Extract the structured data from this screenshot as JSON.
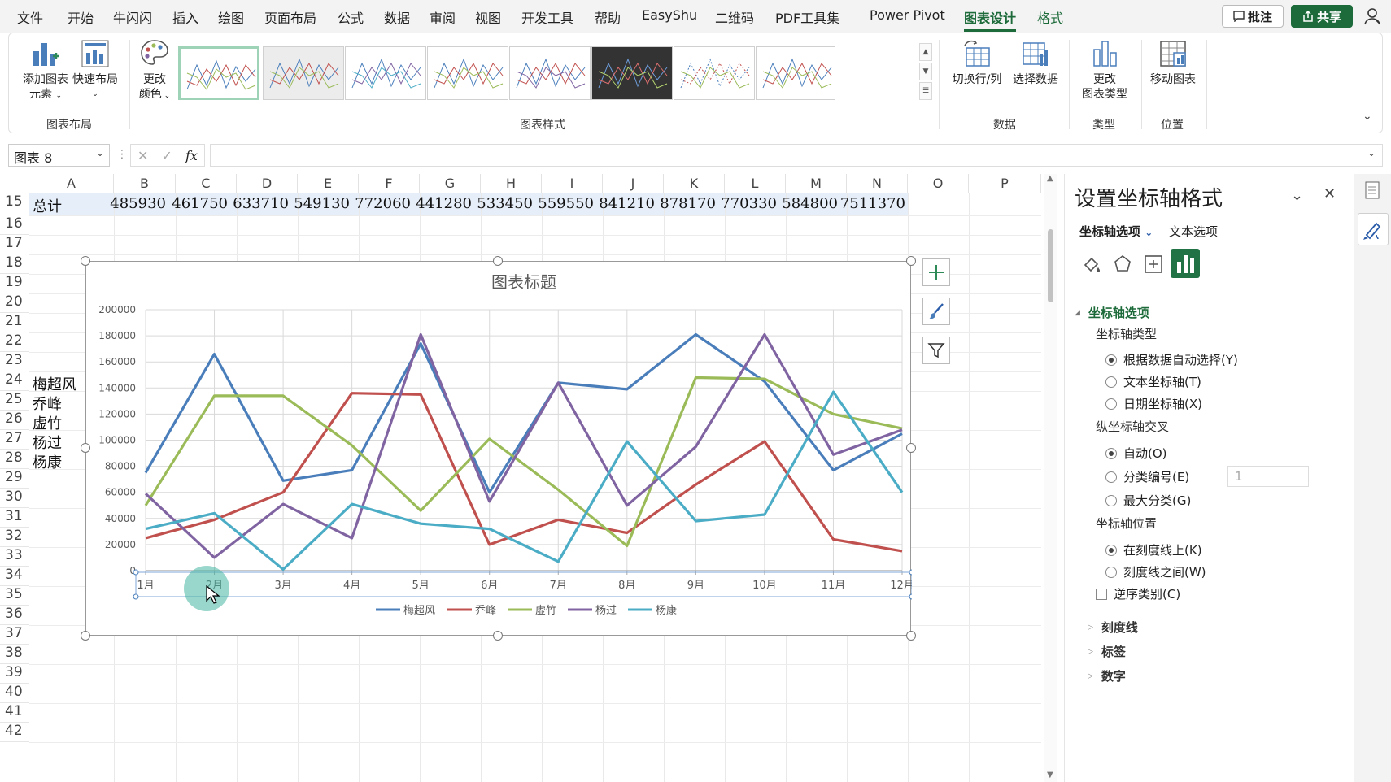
{
  "menu": {
    "items": [
      "文件",
      "开始",
      "牛闪闪",
      "插入",
      "绘图",
      "页面布局",
      "公式",
      "数据",
      "审阅",
      "视图",
      "开发工具",
      "帮助",
      "EasyShu",
      "二维码",
      "PDF工具集",
      "Power Pivot",
      "图表设计",
      "格式"
    ],
    "comment_label": "批注",
    "share_label": "共享"
  },
  "ribbon": {
    "add_element_l1": "添加图表",
    "add_element_l2": "元素",
    "quick_layout": "快速布局",
    "group_layout": "图表布局",
    "change_color_l1": "更改",
    "change_color_l2": "颜色",
    "group_styles": "图表样式",
    "switch_rowcol": "切换行/列",
    "select_data": "选择数据",
    "group_data": "数据",
    "change_type_l1": "更改",
    "change_type_l2": "图表类型",
    "group_type": "类型",
    "move_chart": "移动图表",
    "group_location": "位置"
  },
  "formula_bar": {
    "name_box": "图表 8",
    "fx": "fx"
  },
  "sheet": {
    "columns": [
      "A",
      "B",
      "C",
      "D",
      "E",
      "F",
      "G",
      "H",
      "I",
      "J",
      "K",
      "L",
      "M",
      "N",
      "O",
      "P"
    ],
    "rows": [
      "15",
      "16",
      "17",
      "18",
      "19",
      "20",
      "21",
      "22",
      "23",
      "24",
      "25",
      "26",
      "27",
      "28",
      "29",
      "30",
      "31",
      "32",
      "33",
      "34",
      "35",
      "36",
      "37",
      "38",
      "39",
      "40",
      "41",
      "42"
    ],
    "total_label": "总计",
    "total_values": [
      "485930",
      "461750",
      "633710",
      "549130",
      "772060",
      "441280",
      "533450",
      "559550",
      "841210",
      "878170",
      "770330",
      "584800",
      "7511370"
    ],
    "names": [
      "梅超风",
      "乔峰",
      "虚竹",
      "杨过",
      "杨康"
    ]
  },
  "chart_data": {
    "type": "line",
    "title": "图表标题",
    "categories": [
      "1月",
      "2月",
      "3月",
      "4月",
      "5月",
      "6月",
      "7月",
      "8月",
      "9月",
      "10月",
      "11月",
      "12月"
    ],
    "ylim": [
      0,
      200000
    ],
    "yticks": [
      "0",
      "20000",
      "40000",
      "60000",
      "80000",
      "100000",
      "120000",
      "140000",
      "160000",
      "180000",
      "200000"
    ],
    "grid": true,
    "legend_position": "bottom",
    "series": [
      {
        "name": "梅超风",
        "color": "#4a7ebb",
        "values": [
          75000,
          166000,
          69000,
          77000,
          174000,
          60000,
          144000,
          139000,
          181000,
          145000,
          77000,
          105000
        ]
      },
      {
        "name": "乔峰",
        "color": "#c0504d",
        "values": [
          25000,
          39000,
          60000,
          136000,
          135000,
          20000,
          39000,
          29000,
          66000,
          99000,
          24000,
          15000
        ]
      },
      {
        "name": "虚竹",
        "color": "#9bbb59",
        "values": [
          50000,
          134000,
          134000,
          96000,
          46000,
          101000,
          62000,
          19000,
          148000,
          147000,
          120000,
          109000
        ]
      },
      {
        "name": "杨过",
        "color": "#8064a2",
        "values": [
          59000,
          10000,
          51000,
          25000,
          181000,
          53000,
          144000,
          50000,
          95000,
          181000,
          89000,
          108000
        ]
      },
      {
        "name": "杨康",
        "color": "#4bacc6",
        "values": [
          32000,
          44000,
          1000,
          51000,
          36000,
          32000,
          7000,
          99000,
          38000,
          43000,
          137000,
          60000
        ]
      }
    ]
  },
  "pane": {
    "title": "设置坐标轴格式",
    "tab_axis_options": "坐标轴选项",
    "tab_text_options": "文本选项",
    "section_axis_options": "坐标轴选项",
    "axis_type_label": "坐标轴类型",
    "auto_select": "根据数据自动选择(Y)",
    "text_axis": "文本坐标轴(T)",
    "date_axis": "日期坐标轴(X)",
    "vertical_cross_label": "纵坐标轴交叉",
    "cross_auto": "自动(O)",
    "cross_category_number": "分类编号(E)",
    "cross_category_value": "1",
    "cross_max_category": "最大分类(G)",
    "axis_position_label": "坐标轴位置",
    "on_tick_marks": "在刻度线上(K)",
    "between_tick_marks": "刻度线之间(W)",
    "reverse_categories": "逆序类别(C)",
    "section_tick_marks": "刻度线",
    "section_labels": "标签",
    "section_number": "数字"
  }
}
